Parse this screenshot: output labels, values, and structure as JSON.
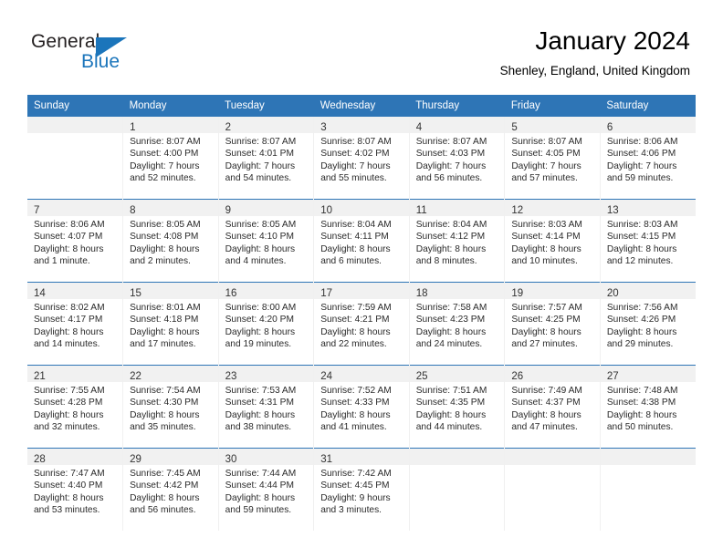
{
  "brand": {
    "name_part1": "General",
    "name_part2": "Blue"
  },
  "header": {
    "title": "January 2024",
    "subtitle": "Shenley, England, United Kingdom"
  },
  "colors": {
    "header_blue": "#2e75b6",
    "logo_blue": "#1b75bb",
    "daynum_band": "#f1f1f1"
  },
  "day_names": [
    "Sunday",
    "Monday",
    "Tuesday",
    "Wednesday",
    "Thursday",
    "Friday",
    "Saturday"
  ],
  "weeks": [
    [
      {
        "day": "",
        "sunrise": "",
        "sunset": "",
        "daylight1": "",
        "daylight2": ""
      },
      {
        "day": "1",
        "sunrise": "Sunrise: 8:07 AM",
        "sunset": "Sunset: 4:00 PM",
        "daylight1": "Daylight: 7 hours",
        "daylight2": "and 52 minutes."
      },
      {
        "day": "2",
        "sunrise": "Sunrise: 8:07 AM",
        "sunset": "Sunset: 4:01 PM",
        "daylight1": "Daylight: 7 hours",
        "daylight2": "and 54 minutes."
      },
      {
        "day": "3",
        "sunrise": "Sunrise: 8:07 AM",
        "sunset": "Sunset: 4:02 PM",
        "daylight1": "Daylight: 7 hours",
        "daylight2": "and 55 minutes."
      },
      {
        "day": "4",
        "sunrise": "Sunrise: 8:07 AM",
        "sunset": "Sunset: 4:03 PM",
        "daylight1": "Daylight: 7 hours",
        "daylight2": "and 56 minutes."
      },
      {
        "day": "5",
        "sunrise": "Sunrise: 8:07 AM",
        "sunset": "Sunset: 4:05 PM",
        "daylight1": "Daylight: 7 hours",
        "daylight2": "and 57 minutes."
      },
      {
        "day": "6",
        "sunrise": "Sunrise: 8:06 AM",
        "sunset": "Sunset: 4:06 PM",
        "daylight1": "Daylight: 7 hours",
        "daylight2": "and 59 minutes."
      }
    ],
    [
      {
        "day": "7",
        "sunrise": "Sunrise: 8:06 AM",
        "sunset": "Sunset: 4:07 PM",
        "daylight1": "Daylight: 8 hours",
        "daylight2": "and 1 minute."
      },
      {
        "day": "8",
        "sunrise": "Sunrise: 8:05 AM",
        "sunset": "Sunset: 4:08 PM",
        "daylight1": "Daylight: 8 hours",
        "daylight2": "and 2 minutes."
      },
      {
        "day": "9",
        "sunrise": "Sunrise: 8:05 AM",
        "sunset": "Sunset: 4:10 PM",
        "daylight1": "Daylight: 8 hours",
        "daylight2": "and 4 minutes."
      },
      {
        "day": "10",
        "sunrise": "Sunrise: 8:04 AM",
        "sunset": "Sunset: 4:11 PM",
        "daylight1": "Daylight: 8 hours",
        "daylight2": "and 6 minutes."
      },
      {
        "day": "11",
        "sunrise": "Sunrise: 8:04 AM",
        "sunset": "Sunset: 4:12 PM",
        "daylight1": "Daylight: 8 hours",
        "daylight2": "and 8 minutes."
      },
      {
        "day": "12",
        "sunrise": "Sunrise: 8:03 AM",
        "sunset": "Sunset: 4:14 PM",
        "daylight1": "Daylight: 8 hours",
        "daylight2": "and 10 minutes."
      },
      {
        "day": "13",
        "sunrise": "Sunrise: 8:03 AM",
        "sunset": "Sunset: 4:15 PM",
        "daylight1": "Daylight: 8 hours",
        "daylight2": "and 12 minutes."
      }
    ],
    [
      {
        "day": "14",
        "sunrise": "Sunrise: 8:02 AM",
        "sunset": "Sunset: 4:17 PM",
        "daylight1": "Daylight: 8 hours",
        "daylight2": "and 14 minutes."
      },
      {
        "day": "15",
        "sunrise": "Sunrise: 8:01 AM",
        "sunset": "Sunset: 4:18 PM",
        "daylight1": "Daylight: 8 hours",
        "daylight2": "and 17 minutes."
      },
      {
        "day": "16",
        "sunrise": "Sunrise: 8:00 AM",
        "sunset": "Sunset: 4:20 PM",
        "daylight1": "Daylight: 8 hours",
        "daylight2": "and 19 minutes."
      },
      {
        "day": "17",
        "sunrise": "Sunrise: 7:59 AM",
        "sunset": "Sunset: 4:21 PM",
        "daylight1": "Daylight: 8 hours",
        "daylight2": "and 22 minutes."
      },
      {
        "day": "18",
        "sunrise": "Sunrise: 7:58 AM",
        "sunset": "Sunset: 4:23 PM",
        "daylight1": "Daylight: 8 hours",
        "daylight2": "and 24 minutes."
      },
      {
        "day": "19",
        "sunrise": "Sunrise: 7:57 AM",
        "sunset": "Sunset: 4:25 PM",
        "daylight1": "Daylight: 8 hours",
        "daylight2": "and 27 minutes."
      },
      {
        "day": "20",
        "sunrise": "Sunrise: 7:56 AM",
        "sunset": "Sunset: 4:26 PM",
        "daylight1": "Daylight: 8 hours",
        "daylight2": "and 29 minutes."
      }
    ],
    [
      {
        "day": "21",
        "sunrise": "Sunrise: 7:55 AM",
        "sunset": "Sunset: 4:28 PM",
        "daylight1": "Daylight: 8 hours",
        "daylight2": "and 32 minutes."
      },
      {
        "day": "22",
        "sunrise": "Sunrise: 7:54 AM",
        "sunset": "Sunset: 4:30 PM",
        "daylight1": "Daylight: 8 hours",
        "daylight2": "and 35 minutes."
      },
      {
        "day": "23",
        "sunrise": "Sunrise: 7:53 AM",
        "sunset": "Sunset: 4:31 PM",
        "daylight1": "Daylight: 8 hours",
        "daylight2": "and 38 minutes."
      },
      {
        "day": "24",
        "sunrise": "Sunrise: 7:52 AM",
        "sunset": "Sunset: 4:33 PM",
        "daylight1": "Daylight: 8 hours",
        "daylight2": "and 41 minutes."
      },
      {
        "day": "25",
        "sunrise": "Sunrise: 7:51 AM",
        "sunset": "Sunset: 4:35 PM",
        "daylight1": "Daylight: 8 hours",
        "daylight2": "and 44 minutes."
      },
      {
        "day": "26",
        "sunrise": "Sunrise: 7:49 AM",
        "sunset": "Sunset: 4:37 PM",
        "daylight1": "Daylight: 8 hours",
        "daylight2": "and 47 minutes."
      },
      {
        "day": "27",
        "sunrise": "Sunrise: 7:48 AM",
        "sunset": "Sunset: 4:38 PM",
        "daylight1": "Daylight: 8 hours",
        "daylight2": "and 50 minutes."
      }
    ],
    [
      {
        "day": "28",
        "sunrise": "Sunrise: 7:47 AM",
        "sunset": "Sunset: 4:40 PM",
        "daylight1": "Daylight: 8 hours",
        "daylight2": "and 53 minutes."
      },
      {
        "day": "29",
        "sunrise": "Sunrise: 7:45 AM",
        "sunset": "Sunset: 4:42 PM",
        "daylight1": "Daylight: 8 hours",
        "daylight2": "and 56 minutes."
      },
      {
        "day": "30",
        "sunrise": "Sunrise: 7:44 AM",
        "sunset": "Sunset: 4:44 PM",
        "daylight1": "Daylight: 8 hours",
        "daylight2": "and 59 minutes."
      },
      {
        "day": "31",
        "sunrise": "Sunrise: 7:42 AM",
        "sunset": "Sunset: 4:45 PM",
        "daylight1": "Daylight: 9 hours",
        "daylight2": "and 3 minutes."
      },
      {
        "day": "",
        "sunrise": "",
        "sunset": "",
        "daylight1": "",
        "daylight2": ""
      },
      {
        "day": "",
        "sunrise": "",
        "sunset": "",
        "daylight1": "",
        "daylight2": ""
      },
      {
        "day": "",
        "sunrise": "",
        "sunset": "",
        "daylight1": "",
        "daylight2": ""
      }
    ]
  ]
}
